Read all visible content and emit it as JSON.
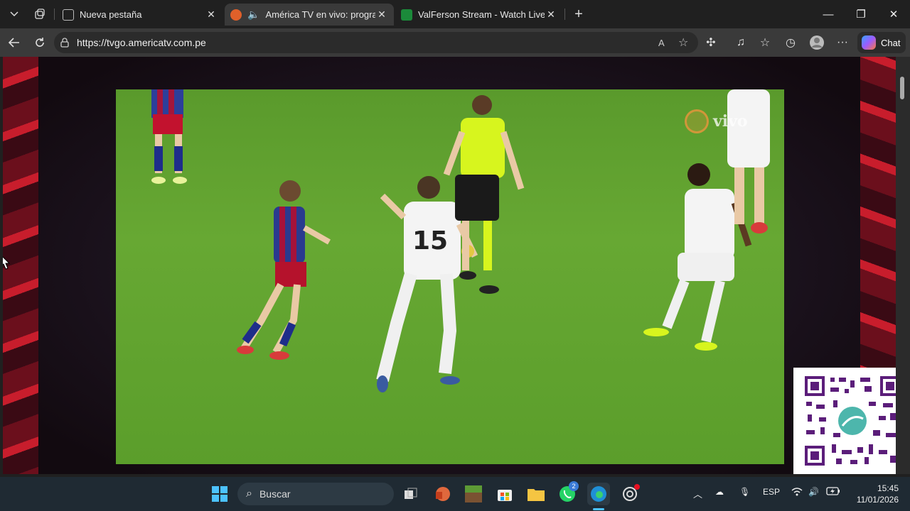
{
  "tabs": [
    {
      "title": "Nueva pestaña",
      "active": false
    },
    {
      "title": "América TV en vivo: programa",
      "active": true
    },
    {
      "title": "ValFerson Stream - Watch Live on",
      "active": false
    }
  ],
  "address_bar": {
    "url": "https://tvgo.americatv.com.pe"
  },
  "toolbar": {
    "chat_label": "Chat"
  },
  "video": {
    "watermark": "vivo",
    "jersey_number": "15"
  },
  "taskbar": {
    "search_placeholder": "Buscar",
    "whatsapp_badge": "2",
    "language": "ESP",
    "time": "15:45",
    "date": "11/01/2026"
  },
  "colors": {
    "accent_red": "#c81d2c",
    "pitch_green": "#62a42f",
    "referee_yellow": "#d7f51e"
  }
}
